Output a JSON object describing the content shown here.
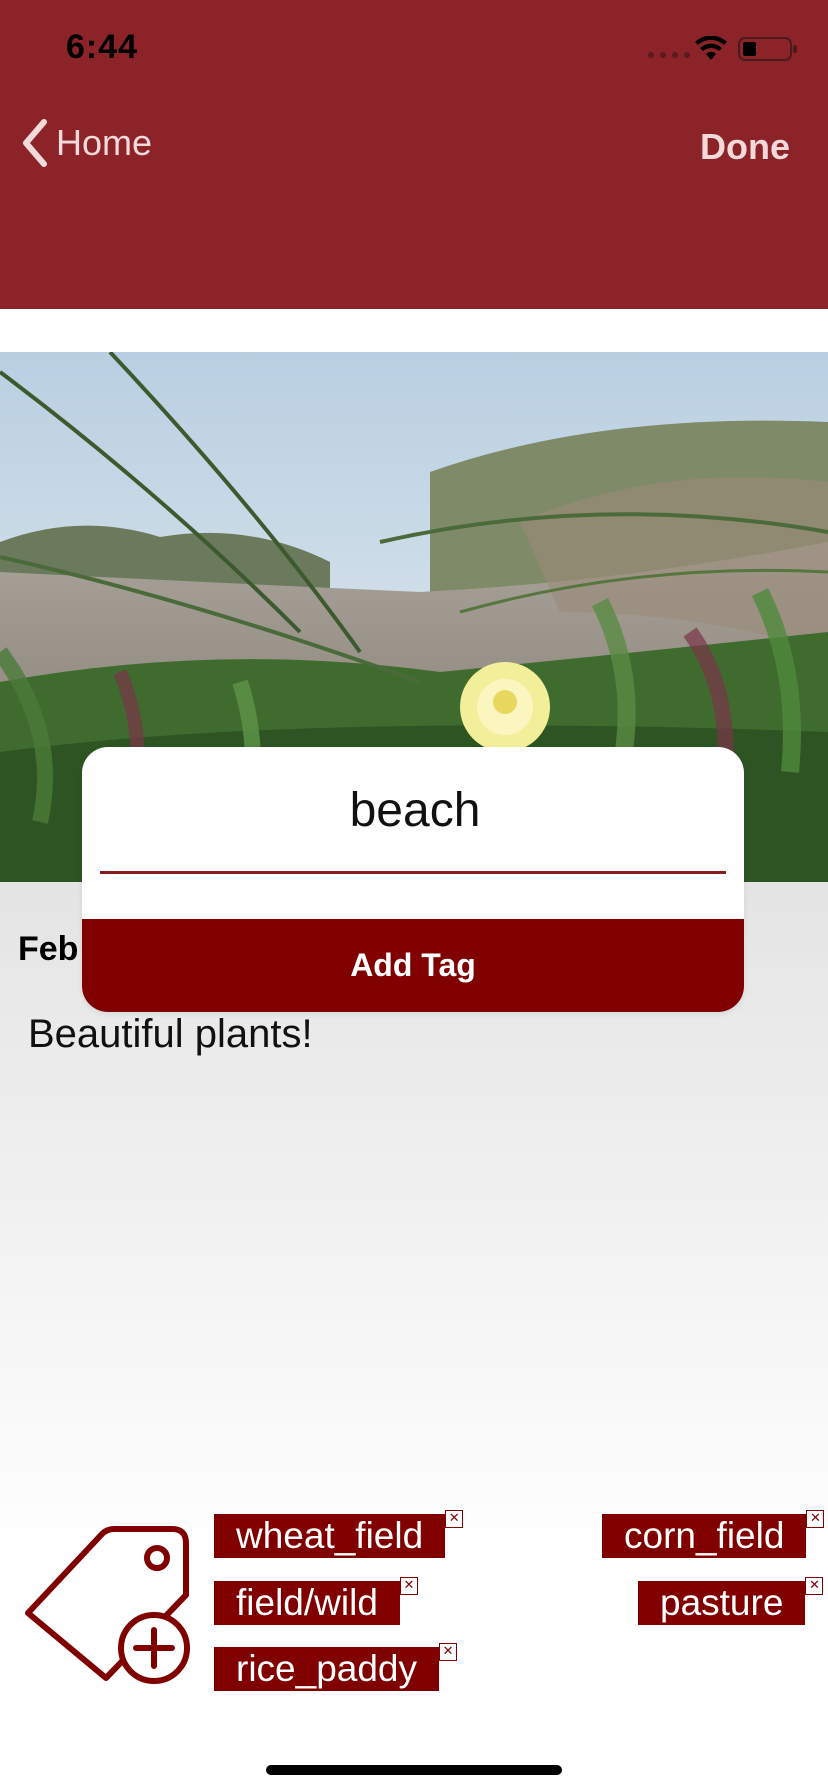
{
  "status_bar": {
    "time": "6:44"
  },
  "nav": {
    "back_label": "Home",
    "done_label": "Done"
  },
  "entry": {
    "date": "Feb",
    "caption": "Beautiful plants!"
  },
  "dialog": {
    "input_value": "beach",
    "add_button_label": "Add Tag"
  },
  "tags": [
    {
      "label": "wheat_field"
    },
    {
      "label": "corn_field"
    },
    {
      "label": "field/wild"
    },
    {
      "label": "pasture"
    },
    {
      "label": "rice_paddy"
    }
  ],
  "colors": {
    "nav_bar": "#8b2329",
    "accent": "#800000"
  },
  "icons": {
    "back": "chevron-left-icon",
    "add_tag": "tag-plus-icon",
    "remove_tag": "close-icon"
  }
}
